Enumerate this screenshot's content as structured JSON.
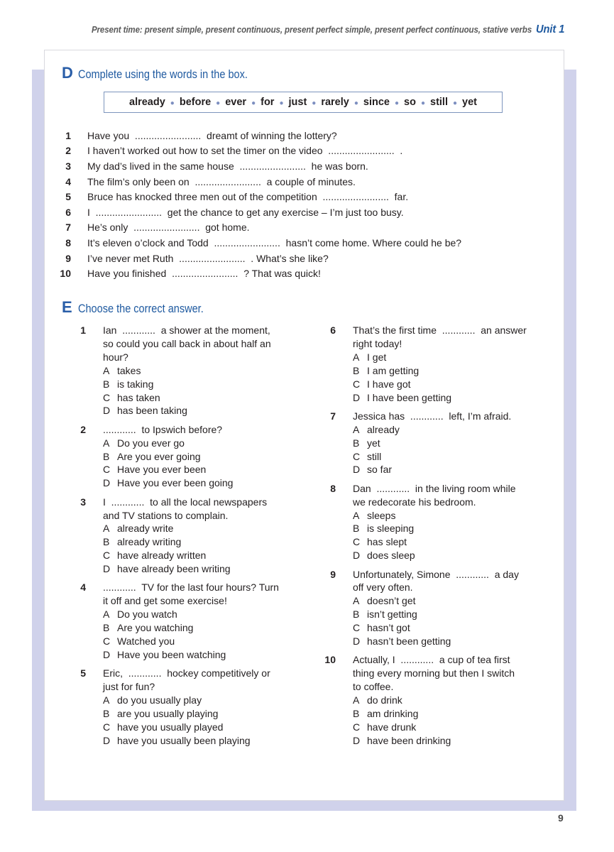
{
  "header": {
    "running_title": "Present time: present simple, present continuous, present perfect simple, present perfect continuous, stative verbs",
    "unit_label": "Unit 1"
  },
  "colors": {
    "accent_blue": "#1f5aa0",
    "panel_lavender": "#d0d2eb",
    "box_border": "#7d95bd"
  },
  "section_d": {
    "letter": "D",
    "instruction": "Complete using the words in the box.",
    "word_box": [
      "already",
      "before",
      "ever",
      "for",
      "just",
      "rarely",
      "since",
      "so",
      "still",
      "yet"
    ],
    "items": [
      {
        "num": "1",
        "text": "Have you  ........................  dreamt of winning the lottery?"
      },
      {
        "num": "2",
        "text": "I haven’t worked out how to set the timer on the video  ........................  ."
      },
      {
        "num": "3",
        "text": "My dad’s lived in the same house  ........................  he was born."
      },
      {
        "num": "4",
        "text": "The film’s only been on  ........................  a couple of minutes."
      },
      {
        "num": "5",
        "text": "Bruce has knocked three men out of the competition  ........................  far."
      },
      {
        "num": "6",
        "text": "I  ........................  get the chance to get any exercise – I’m just too busy."
      },
      {
        "num": "7",
        "text": "He’s only  ........................  got home."
      },
      {
        "num": "8",
        "text": "It’s eleven o’clock and Todd  ........................  hasn’t come home. Where could he be?"
      },
      {
        "num": "9",
        "text": "I’ve never met Ruth  ........................  . What’s she like?"
      },
      {
        "num": "10",
        "text": "Have you finished  ........................  ? That was quick!"
      }
    ]
  },
  "section_e": {
    "letter": "E",
    "instruction": "Choose the correct answer.",
    "left_questions": [
      {
        "num": "1",
        "lines": [
          "Ian  ............  a shower at the moment,",
          "so could you call back in about half an",
          "hour?"
        ],
        "options": [
          {
            "l": "A",
            "t": "takes"
          },
          {
            "l": "B",
            "t": "is taking"
          },
          {
            "l": "C",
            "t": "has taken"
          },
          {
            "l": "D",
            "t": "has been taking"
          }
        ]
      },
      {
        "num": "2",
        "lines": [
          "............  to Ipswich before?"
        ],
        "options": [
          {
            "l": "A",
            "t": "Do you ever go"
          },
          {
            "l": "B",
            "t": "Are you ever going"
          },
          {
            "l": "C",
            "t": "Have you ever been"
          },
          {
            "l": "D",
            "t": "Have you ever been going"
          }
        ]
      },
      {
        "num": "3",
        "lines": [
          "I  ............  to all the local newspapers",
          "and TV stations to complain."
        ],
        "options": [
          {
            "l": "A",
            "t": "already write"
          },
          {
            "l": "B",
            "t": "already writing"
          },
          {
            "l": "C",
            "t": "have already written"
          },
          {
            "l": "D",
            "t": "have already been writing"
          }
        ]
      },
      {
        "num": "4",
        "lines": [
          "............  TV for the last four hours? Turn",
          "it off and get some exercise!"
        ],
        "options": [
          {
            "l": "A",
            "t": "Do you watch"
          },
          {
            "l": "B",
            "t": "Are you watching"
          },
          {
            "l": "C",
            "t": "Watched you"
          },
          {
            "l": "D",
            "t": "Have you been watching"
          }
        ]
      },
      {
        "num": "5",
        "lines": [
          "Eric,  ............  hockey competitively or",
          "just for fun?"
        ],
        "options": [
          {
            "l": "A",
            "t": "do you usually play"
          },
          {
            "l": "B",
            "t": "are you usually playing"
          },
          {
            "l": "C",
            "t": "have you usually played"
          },
          {
            "l": "D",
            "t": "have you usually been playing"
          }
        ]
      }
    ],
    "right_questions": [
      {
        "num": "6",
        "lines": [
          "That’s the first time  ............  an answer",
          "right today!"
        ],
        "options": [
          {
            "l": "A",
            "t": "I get"
          },
          {
            "l": "B",
            "t": "I am getting"
          },
          {
            "l": "C",
            "t": "I have got"
          },
          {
            "l": "D",
            "t": "I have been getting"
          }
        ]
      },
      {
        "num": "7",
        "lines": [
          "Jessica has  ............  left, I’m afraid."
        ],
        "options": [
          {
            "l": "A",
            "t": "already"
          },
          {
            "l": "B",
            "t": "yet"
          },
          {
            "l": "C",
            "t": "still"
          },
          {
            "l": "D",
            "t": "so far"
          }
        ]
      },
      {
        "num": "8",
        "lines": [
          "Dan  ............  in the living room while",
          "we redecorate his bedroom."
        ],
        "options": [
          {
            "l": "A",
            "t": "sleeps"
          },
          {
            "l": "B",
            "t": "is sleeping"
          },
          {
            "l": "C",
            "t": "has slept"
          },
          {
            "l": "D",
            "t": "does sleep"
          }
        ]
      },
      {
        "num": "9",
        "lines": [
          "Unfortunately, Simone  ............  a day",
          "off very often."
        ],
        "options": [
          {
            "l": "A",
            "t": "doesn’t get"
          },
          {
            "l": "B",
            "t": "isn’t getting"
          },
          {
            "l": "C",
            "t": "hasn’t got"
          },
          {
            "l": "D",
            "t": "hasn’t been getting"
          }
        ]
      },
      {
        "num": "10",
        "lines": [
          "Actually, I  ............  a cup of tea first",
          "thing every morning but then I switch",
          "to coffee."
        ],
        "options": [
          {
            "l": "A",
            "t": "do drink"
          },
          {
            "l": "B",
            "t": "am drinking"
          },
          {
            "l": "C",
            "t": "have drunk"
          },
          {
            "l": "D",
            "t": "have been drinking"
          }
        ]
      }
    ]
  },
  "footer": {
    "page_number": "9"
  }
}
